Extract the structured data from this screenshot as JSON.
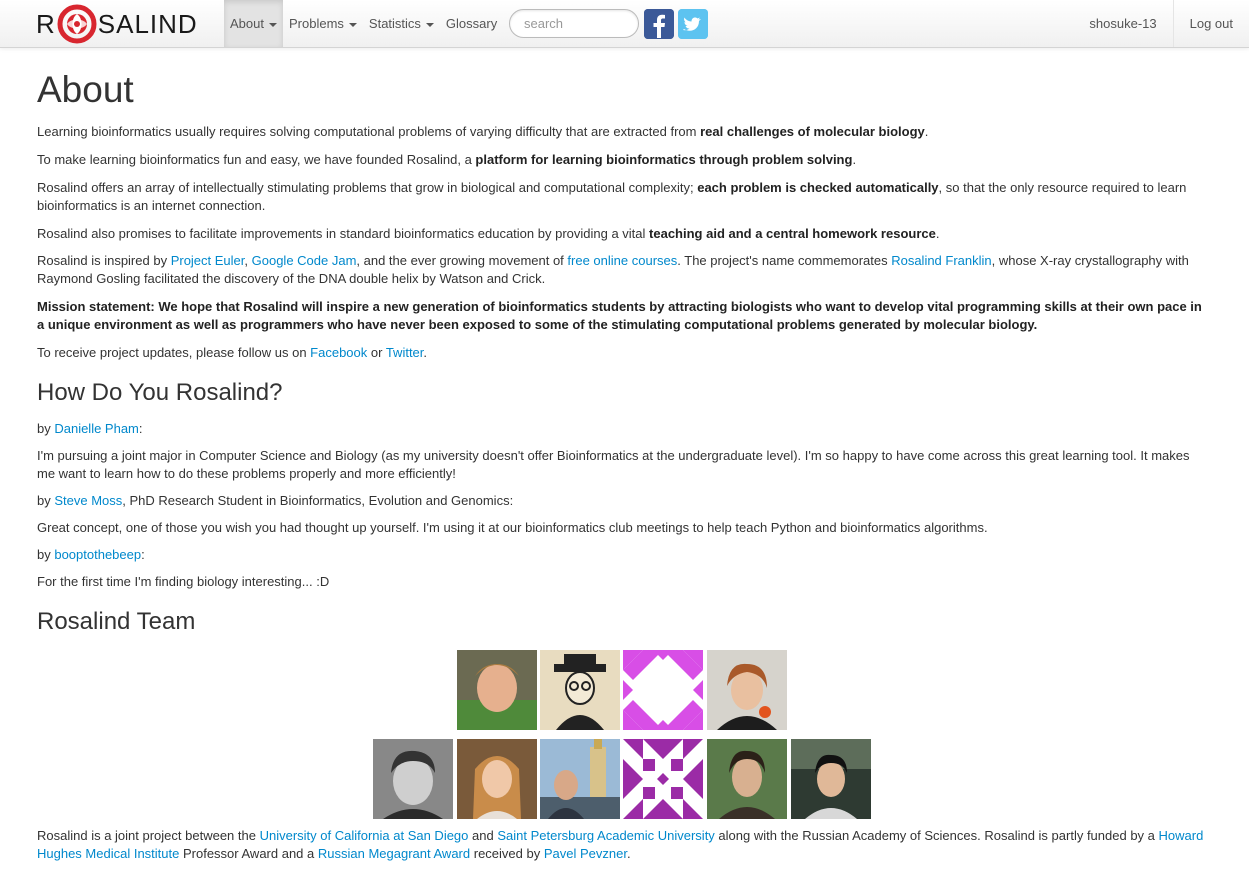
{
  "brand": {
    "prefix": "R",
    "suffix": "SALIND"
  },
  "nav": {
    "about": "About",
    "problems": "Problems",
    "statistics": "Statistics",
    "glossary": "Glossary",
    "search_placeholder": "search",
    "username": "shosuke-13",
    "logout": "Log out"
  },
  "colors": {
    "link": "#0088cc",
    "facebook": "#3b5998",
    "twitter": "#5dc3f0",
    "logo_red": "#d8262f"
  },
  "about": {
    "title": "About",
    "p1": {
      "text": "Learning bioinformatics usually requires solving computational problems of varying difficulty that are extracted from ",
      "bold": "real challenges of molecular biology",
      "end": "."
    },
    "p2": {
      "text": "To make learning bioinformatics fun and easy, we have founded Rosalind, a ",
      "bold": "platform for learning bioinformatics through problem solving",
      "end": "."
    },
    "p3": {
      "text": "Rosalind offers an array of intellectually stimulating problems that grow in biological and computational complexity; ",
      "bold": "each problem is checked automatically",
      "end": ", so that the only resource required to learn bioinformatics is an internet connection."
    },
    "p4": {
      "text": "Rosalind also promises to facilitate improvements in standard bioinformatics education by providing a vital ",
      "bold": "teaching aid and a central homework resource",
      "end": "."
    },
    "p5": {
      "t1": "Rosalind is inspired by ",
      "l1": "Project Euler",
      "t2": ", ",
      "l2": "Google Code Jam",
      "t3": ", and the ever growing movement of ",
      "l3": "free online courses",
      "t4": ". The project's name commemorates ",
      "l4": "Rosalind Franklin",
      "t5": ", whose X-ray crystallography with Raymond Gosling facilitated the discovery of the DNA double helix by Watson and Crick."
    },
    "mission": "Mission statement: We hope that Rosalind will inspire a new generation of bioinformatics students by attracting biologists who want to develop vital programming skills at their own pace in a unique environment as well as programmers who have never been exposed to some of the stimulating computational problems generated by molecular biology.",
    "follow": {
      "t1": "To receive project updates, please follow us on ",
      "l1": "Facebook",
      "t2": " or ",
      "l2": "Twitter",
      "t3": "."
    }
  },
  "testimonials": {
    "title": "How Do You Rosalind?",
    "by": "by ",
    "items": [
      {
        "author": "Danielle Pham",
        "suffix": ":",
        "quote": "I'm pursuing a joint major in Computer Science and Biology (as my university doesn't offer Bioinformatics at the undergraduate level). I'm so happy to have come across this great learning tool. It makes me want to learn how to do these problems properly and more efficiently!"
      },
      {
        "author": "Steve Moss",
        "suffix": ", PhD Research Student in Bioinformatics, Evolution and Genomics:",
        "quote": "Great concept, one of those you wish you had thought up yourself. I'm using it at our bioinformatics club meetings to help teach Python and bioinformatics algorithms."
      },
      {
        "author": "booptothebeep",
        "suffix": ":",
        "quote": "For the first time I'm finding biology interesting... :D"
      }
    ]
  },
  "team": {
    "title": "Rosalind Team",
    "footer": {
      "t1": "Rosalind is a joint project between the ",
      "l1": "University of California at San Diego",
      "t2": " and ",
      "l2": "Saint Petersburg Academic University",
      "t3": " along with the Russian Academy of Sciences. Rosalind is partly funded by a ",
      "l3": "Howard Hughes Medical Institute",
      "t4": " Professor Award and a ",
      "l4": "Russian Megagrant Award",
      "t5": " received by ",
      "l5": "Pavel Pevzner",
      "t6": "."
    }
  }
}
